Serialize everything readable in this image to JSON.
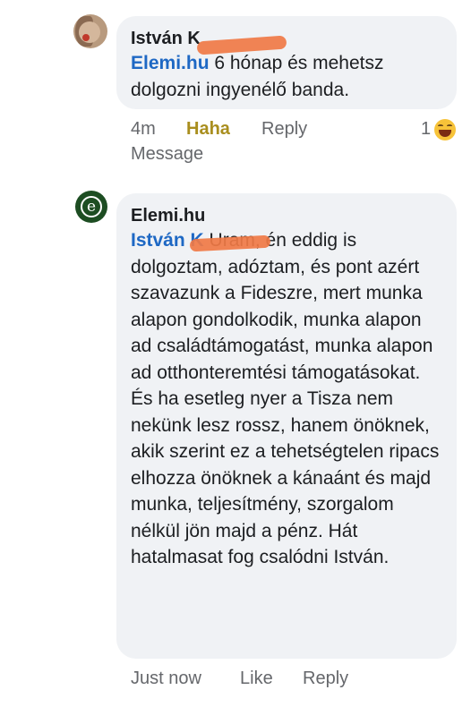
{
  "comments": [
    {
      "author": "István K",
      "mention": "Elemi.hu",
      "text": " 6 hónap és mehetsz dolgozni ingyenélő banda.",
      "time": "4m",
      "reaction_action": "Haha",
      "reply": "Reply",
      "reaction_count": "1",
      "message": "Message",
      "reaction_icon": "laughing-emoji-icon"
    },
    {
      "author": "Elemi.hu",
      "mention": "István K",
      "text": " Uram, én eddig is dolgoztam, adóztam, és pont azért szavazunk a Fideszre, mert munka alapon gondolkodik, munka alapon ad családtámogatást, munka alapon ad otthonteremtési támogatásokat. És ha esetleg nyer a Tisza nem nekünk lesz rossz, hanem önöknek, akik szerint ez a tehetségtelen ripacs elhozza önöknek a kánaánt és majd munka, teljesítmény, szorgalom nélkül jön majd a pénz. Hát hatalmasat fog csalódni István.",
      "time": "Just now",
      "like": "Like",
      "reply": "Reply",
      "avatar_letter": "e"
    }
  ],
  "colors": {
    "bubble": "#f0f2f5",
    "mention": "#1e68c4",
    "haha": "#a98e1e",
    "meta": "#65676b",
    "redaction": "#f07a45"
  }
}
